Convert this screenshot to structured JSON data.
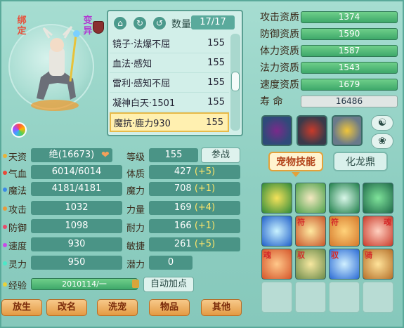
{
  "pet": {
    "badge_bound": "绑定",
    "badge_mutant": "变异"
  },
  "skill_list": {
    "count_label": "数量",
    "count_value": "17/17",
    "rows": [
      {
        "name": "镜子·法爆不屈",
        "value": "155"
      },
      {
        "name": "血法·感知",
        "value": "155"
      },
      {
        "name": "雷利·感知不屈",
        "value": "155"
      },
      {
        "name": "凝神白天·1501",
        "value": "155"
      },
      {
        "name": "魔抗·鹿力930",
        "value": "155"
      }
    ]
  },
  "aptitudes": [
    {
      "label": "攻击资质",
      "value": "1374"
    },
    {
      "label": "防御资质",
      "value": "1590"
    },
    {
      "label": "体力资质",
      "value": "1587"
    },
    {
      "label": "法力资质",
      "value": "1543"
    },
    {
      "label": "速度资质",
      "value": "1679"
    },
    {
      "label": "寿    命",
      "value": "16486"
    }
  ],
  "side_buttons": {
    "yinyang": "☯",
    "paw": "❀"
  },
  "tabs": {
    "active": "宠物技能",
    "inactive": "化龙鼎"
  },
  "skill_marks": [
    "符",
    "符",
    "魂",
    "魂",
    "驭",
    "驭",
    "骑"
  ],
  "stats": [
    {
      "label": "天资",
      "value": "绝(16673)",
      "dot": "#e8b23a"
    },
    {
      "label": "气血",
      "value": "6014/6014",
      "dot": "#e84a3a"
    },
    {
      "label": "魔法",
      "value": "4181/4181",
      "dot": "#3a8ae8"
    },
    {
      "label": "攻击",
      "value": "1032",
      "dot": "#e89a3a"
    },
    {
      "label": "防御",
      "value": "1098",
      "dot": "#e84a6a"
    },
    {
      "label": "速度",
      "value": "930",
      "dot": "#c84ae8"
    },
    {
      "label": "灵力",
      "value": "950",
      "dot": "#4ae8c8"
    }
  ],
  "attributes": [
    {
      "label": "等级",
      "value": "155",
      "bonus": ""
    },
    {
      "label": "体质",
      "value": "427",
      "bonus": "(+5)"
    },
    {
      "label": "魔力",
      "value": "708",
      "bonus": "(+1)"
    },
    {
      "label": "力量",
      "value": "169",
      "bonus": "(+4)"
    },
    {
      "label": "耐力",
      "value": "166",
      "bonus": "(+1)"
    },
    {
      "label": "敏捷",
      "value": "261",
      "bonus": "(+5)"
    },
    {
      "label": "潜力",
      "value": "0",
      "bonus": ""
    }
  ],
  "fight_button": "参战",
  "exp": {
    "label": "经验",
    "value": "2010114/一"
  },
  "auto_button": "自动加点",
  "bottom_buttons": [
    "放生",
    "改名",
    "洗宠",
    "物品",
    "其他"
  ],
  "colors": {
    "accent": "#e3a13a",
    "bar_green": "#3ea86a",
    "panel": "#8fcfc2"
  }
}
